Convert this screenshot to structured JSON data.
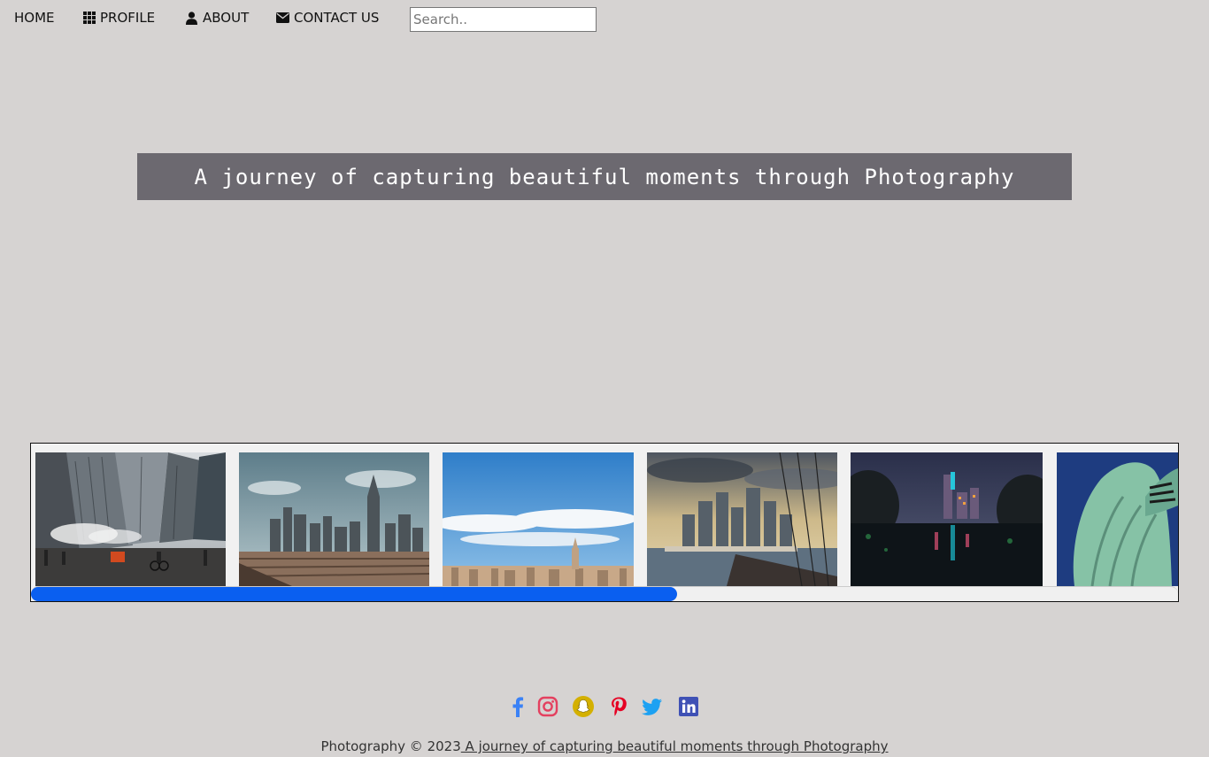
{
  "nav": {
    "home_label": "HOME",
    "profile_label": "PROFILE",
    "about_label": "ABOUT",
    "contact_label": "CONTACT US",
    "search_placeholder": "Search.."
  },
  "hero": {
    "tagline": "A journey of capturing beautiful moments through Photography"
  },
  "gallery": {
    "photos": [
      {
        "subject": "city street with steam and glass skyscrapers"
      },
      {
        "subject": "Lower Manhattan skyline from Brooklyn Bridge"
      },
      {
        "subject": "Manhattan skyline under blue sky with clouds"
      },
      {
        "subject": "Lower Manhattan waterfront at dusk"
      },
      {
        "subject": "Central Park lake with city lights at night"
      },
      {
        "subject": "Statue of Liberty detail"
      }
    ],
    "scroll_position": 0.56
  },
  "socials": [
    {
      "name": "facebook-icon",
      "color": "#3b82f6"
    },
    {
      "name": "instagram-icon",
      "color": "#e4405f"
    },
    {
      "name": "snapchat-icon",
      "color": "#d4b000"
    },
    {
      "name": "pinterest-icon",
      "color": "#e60023"
    },
    {
      "name": "twitter-icon",
      "color": "#1da1f2"
    },
    {
      "name": "linkedin-icon",
      "color": "#3f51b5"
    }
  ],
  "footer": {
    "text": "Photography © 2023",
    "link_text": " A journey of capturing beautiful moments through Photography"
  },
  "colors": {
    "background": "#d6d3d2",
    "hero_bg": "#6c6970",
    "scroll_thumb": "#0a5ff0"
  }
}
